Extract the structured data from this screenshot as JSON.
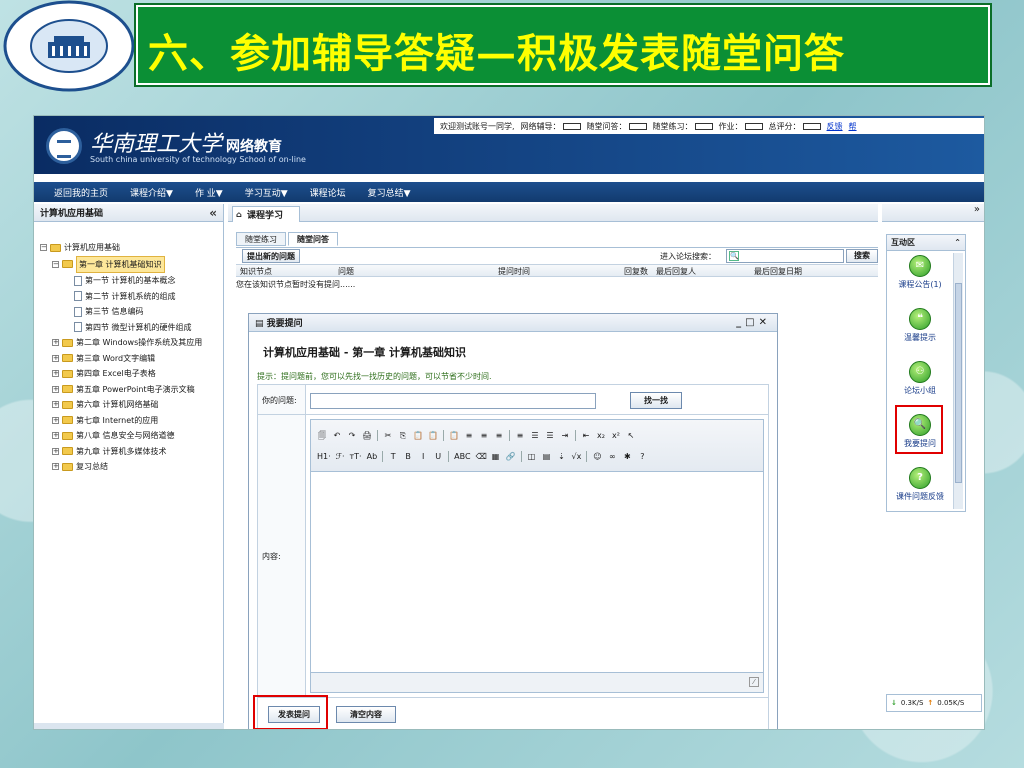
{
  "slide": {
    "title": "六、参加辅导答疑—积极发表随堂问答"
  },
  "site": {
    "brand": "华南理工大学",
    "brand_sub": "网络教育",
    "tagline": "South china university of technology School of on-line"
  },
  "status": {
    "welcome": "欢迎测试账号一同学,",
    "items": [
      {
        "label": "网络辅导："
      },
      {
        "label": "随堂问答："
      },
      {
        "label": "随堂练习："
      },
      {
        "label": "作业："
      },
      {
        "label": "总评分："
      }
    ],
    "feedback": "反馈",
    "help": "帮"
  },
  "nav": {
    "items": [
      "返回我的主页",
      "课程介绍▼",
      "作 业▼",
      "学习互动▼",
      "课程论坛",
      "复习总结▼"
    ]
  },
  "left": {
    "title": "计算机应用基础",
    "tree": [
      {
        "label": "计算机应用基础",
        "level": 0,
        "kind": "folder",
        "toggle": "⊟"
      },
      {
        "label": "第一章 计算机基础知识",
        "level": 1,
        "kind": "folder",
        "toggle": "⊟",
        "selected": true
      },
      {
        "label": "第一节 计算机的基本概念",
        "level": 2,
        "kind": "file"
      },
      {
        "label": "第二节 计算机系统的组成",
        "level": 2,
        "kind": "file"
      },
      {
        "label": "第三节 信息编码",
        "level": 2,
        "kind": "file"
      },
      {
        "label": "第四节 微型计算机的硬件组成",
        "level": 2,
        "kind": "file"
      },
      {
        "label": "第二章 Windows操作系统及其应用",
        "level": 1,
        "kind": "folder",
        "toggle": "⊞"
      },
      {
        "label": "第三章 Word文字编辑",
        "level": 1,
        "kind": "folder",
        "toggle": "⊞"
      },
      {
        "label": "第四章 Excel电子表格",
        "level": 1,
        "kind": "folder",
        "toggle": "⊞"
      },
      {
        "label": "第五章 PowerPoint电子演示文稿",
        "level": 1,
        "kind": "folder",
        "toggle": "⊞"
      },
      {
        "label": "第六章 计算机网络基础",
        "level": 1,
        "kind": "folder",
        "toggle": "⊞"
      },
      {
        "label": "第七章 Internet的应用",
        "level": 1,
        "kind": "folder",
        "toggle": "⊞"
      },
      {
        "label": "第八章 信息安全与网络道德",
        "level": 1,
        "kind": "folder",
        "toggle": "⊞"
      },
      {
        "label": "第九章 计算机多媒体技术",
        "level": 1,
        "kind": "folder",
        "toggle": "⊞"
      },
      {
        "label": "复习总结",
        "level": 1,
        "kind": "folder",
        "toggle": "⊞"
      }
    ]
  },
  "main": {
    "tab": "课程学习",
    "subtabs": [
      "随堂练习",
      "随堂问答"
    ],
    "new_question": "提出新的问题",
    "forum_search_label": "进入论坛搜索：",
    "search_button": "搜索",
    "columns": [
      "知识节点",
      "问题",
      "提问时间",
      "回复数",
      "最后回复人",
      "最后回复日期"
    ],
    "empty": "您在该知识节点暂时没有提问......"
  },
  "dialog": {
    "title": "我要提问",
    "controls": "_□✕",
    "course": "计算机应用基础 - 第一章 计算机基础知识",
    "tip": "提示：提问题前，您可以先找一找历史的问题，可以节省不少时间.",
    "question_label": "你的问题:",
    "find_button": "找一找",
    "content_label": "内容:",
    "toolbar_row1": [
      "🗐",
      "↶",
      "↷",
      "🖨",
      "✂",
      "⎘",
      "📋",
      "📋",
      "📋",
      "≡",
      "≡",
      "≡",
      "≡",
      "☰",
      "☰",
      "⇥",
      "⇤",
      "x₂",
      "x²",
      "↖"
    ],
    "toolbar_row2": [
      "H1·",
      "ℱ·",
      "тT·",
      "Ab",
      "T",
      "B",
      "I",
      "U",
      "ABC",
      "⌫",
      "▦",
      "🔗",
      "◫",
      "▤",
      "⇣",
      "√x",
      "☺",
      "∞",
      "✱",
      "?"
    ],
    "publish_button": "发表提问",
    "clear_button": "清空内容"
  },
  "right": {
    "title": "互动区",
    "items": [
      {
        "label": "课程公告(1)",
        "icon": "✉"
      },
      {
        "label": "温馨提示",
        "icon": "❝"
      },
      {
        "label": "论坛小组",
        "icon": "⚇"
      },
      {
        "label": "我要提问",
        "icon": "🔍"
      },
      {
        "label": "课件问题反馈",
        "icon": "?"
      }
    ],
    "down_speed": "0.3K/S",
    "up_speed": "0.05K/S"
  },
  "colors": {
    "title_bg": "#0b8f35",
    "title_text": "#ffff00",
    "highlight": "#e00000"
  }
}
